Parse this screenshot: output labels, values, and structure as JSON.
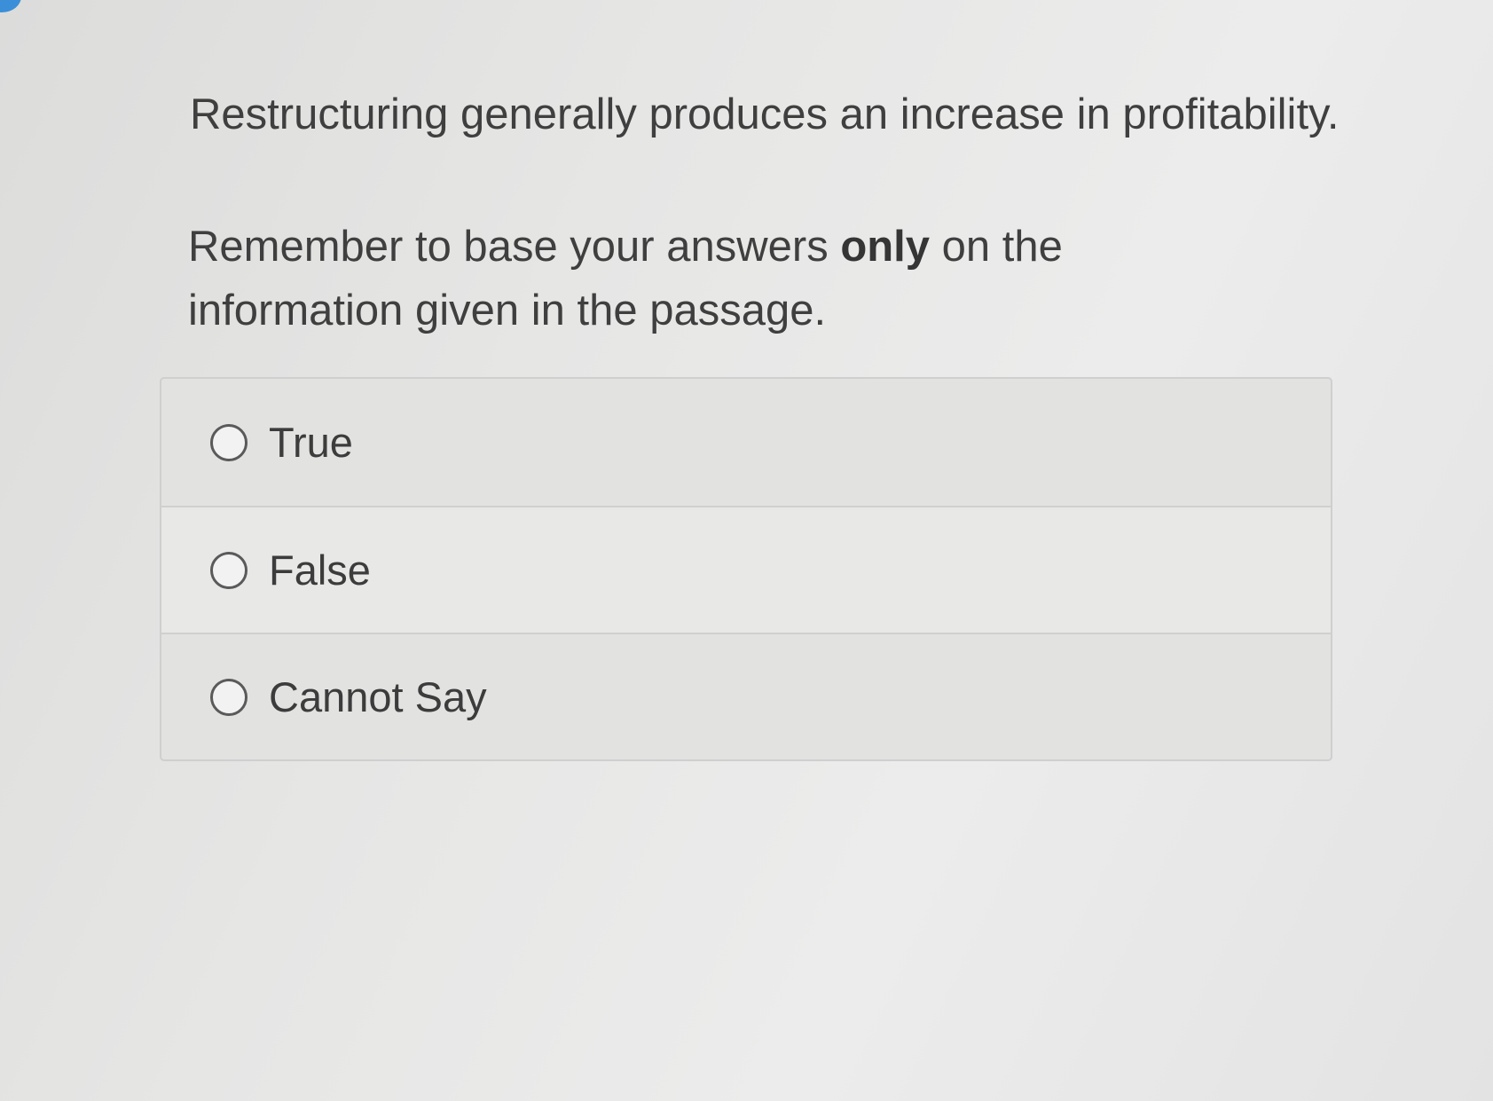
{
  "question": {
    "statement": "Restructuring generally produces an increase in profitability.",
    "instruction_before": "Remember to base your answers ",
    "instruction_emphasis": "only",
    "instruction_after": " on the information given in the passage."
  },
  "options": [
    {
      "label": "True",
      "selected": false
    },
    {
      "label": "False",
      "selected": false
    },
    {
      "label": "Cannot Say",
      "selected": false
    }
  ],
  "colors": {
    "background": "#e6e6e5",
    "text": "#3f3f3f",
    "option_panel": "#e2e2e1",
    "corner_accent": "#3b8fd8"
  }
}
